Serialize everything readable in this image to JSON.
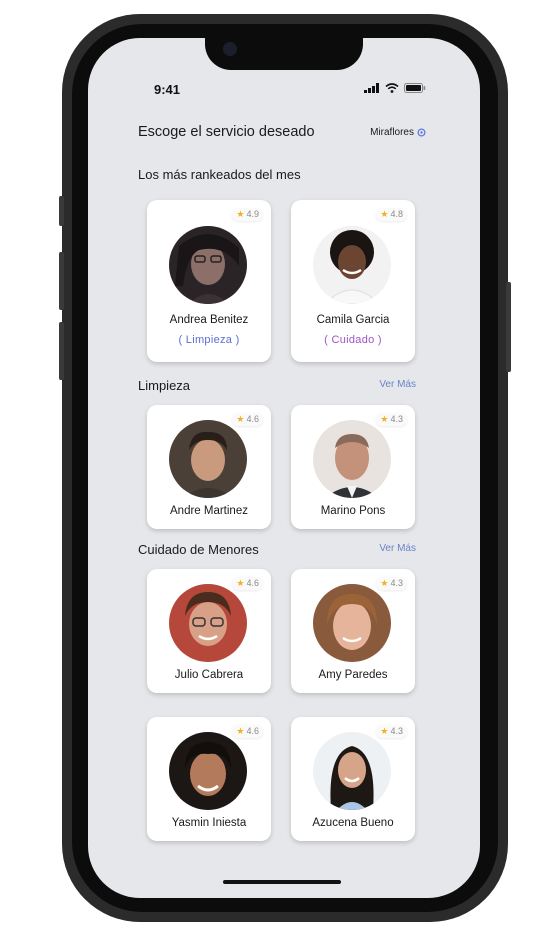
{
  "status": {
    "time": "9:41"
  },
  "header": {
    "title": "Escoge el servicio deseado",
    "location": "Miraflores",
    "location_icon": "location-pin-icon"
  },
  "sections": {
    "top": {
      "title": "Los más rankeados del mes",
      "cards": [
        {
          "name": "Andrea Benitez",
          "rating": "4.9",
          "tag": "( Limpieza )",
          "tag_color": "#5a6fd0"
        },
        {
          "name": "Camila Garcia",
          "rating": "4.8",
          "tag": "( Cuidado )",
          "tag_color": "#9a55c8"
        }
      ]
    },
    "limpieza": {
      "title": "Limpieza",
      "see_more": "Ver Más",
      "cards": [
        {
          "name": "Andre Martinez",
          "rating": "4.6"
        },
        {
          "name": "Marino Pons",
          "rating": "4.3"
        }
      ]
    },
    "cuidado": {
      "title": "Cuidado de Menores",
      "see_more": "Ver Más",
      "cards": [
        {
          "name": "Julio Cabrera",
          "rating": "4.6"
        },
        {
          "name": "Amy Paredes",
          "rating": "4.3"
        },
        {
          "name": "Yasmin Iniesta",
          "rating": "4.6"
        },
        {
          "name": "Azucena Bueno",
          "rating": "4.3"
        }
      ]
    }
  },
  "colors": {
    "background": "#e6e7ea",
    "star": "#f2b01e",
    "link": "#6b84c9"
  }
}
